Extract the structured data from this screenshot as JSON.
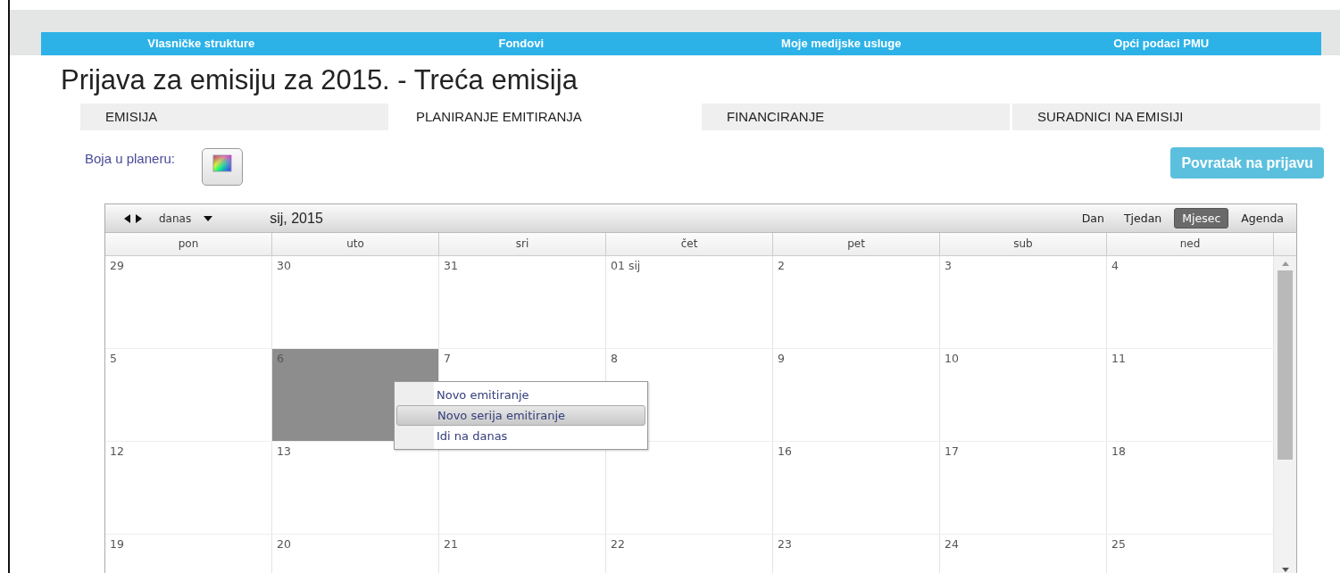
{
  "nav": [
    {
      "label": "Vlasničke strukture"
    },
    {
      "label": "Fondovi"
    },
    {
      "label": "Moje medijske usluge"
    },
    {
      "label": "Opći podaci PMU"
    }
  ],
  "title": "Prijava za emisiju za 2015. - Treća emisija",
  "tabs": [
    {
      "label": "EMISIJA",
      "selected": false
    },
    {
      "label": "PLANIRANJE EMITIRANJA",
      "selected": true
    },
    {
      "label": "FINANCIRANJE",
      "selected": false
    },
    {
      "label": "SURADNICI NA EMISIJI",
      "selected": false
    }
  ],
  "color_label": "Boja u planeru:",
  "back_button": "Povratak na prijavu",
  "calendar": {
    "today_label": "danas",
    "period": "sij, 2015",
    "views": [
      {
        "label": "Dan",
        "selected": false
      },
      {
        "label": "Tjedan",
        "selected": false
      },
      {
        "label": "Mjesec",
        "selected": true
      },
      {
        "label": "Agenda",
        "selected": false
      }
    ],
    "weekdays": [
      "pon",
      "uto",
      "sri",
      "čet",
      "pet",
      "sub",
      "ned"
    ],
    "weeks": [
      [
        {
          "label": "29",
          "selected": false
        },
        {
          "label": "30",
          "selected": false
        },
        {
          "label": "31",
          "selected": false
        },
        {
          "label": "01 sij",
          "selected": false
        },
        {
          "label": "2",
          "selected": false
        },
        {
          "label": "3",
          "selected": false
        },
        {
          "label": "4",
          "selected": false
        }
      ],
      [
        {
          "label": "5",
          "selected": false
        },
        {
          "label": "6",
          "selected": true
        },
        {
          "label": "7",
          "selected": false
        },
        {
          "label": "8",
          "selected": false
        },
        {
          "label": "9",
          "selected": false
        },
        {
          "label": "10",
          "selected": false
        },
        {
          "label": "11",
          "selected": false
        }
      ],
      [
        {
          "label": "12",
          "selected": false
        },
        {
          "label": "13",
          "selected": false
        },
        {
          "selected": false
        },
        {
          "selected": false
        },
        {
          "label": "16",
          "selected": false
        },
        {
          "label": "17",
          "selected": false
        },
        {
          "label": "18",
          "selected": false
        }
      ],
      [
        {
          "label": "19",
          "selected": false
        },
        {
          "label": "20",
          "selected": false
        },
        {
          "label": "21",
          "selected": false
        },
        {
          "label": "22",
          "selected": false
        },
        {
          "label": "23",
          "selected": false
        },
        {
          "label": "24",
          "selected": false
        },
        {
          "label": "25",
          "selected": false
        }
      ]
    ]
  },
  "context_menu": [
    {
      "label": "Novo emitiranje",
      "selected": false
    },
    {
      "label": "Novo serija emitiranje",
      "selected": true
    },
    {
      "label": "Idi na danas",
      "selected": false
    }
  ]
}
